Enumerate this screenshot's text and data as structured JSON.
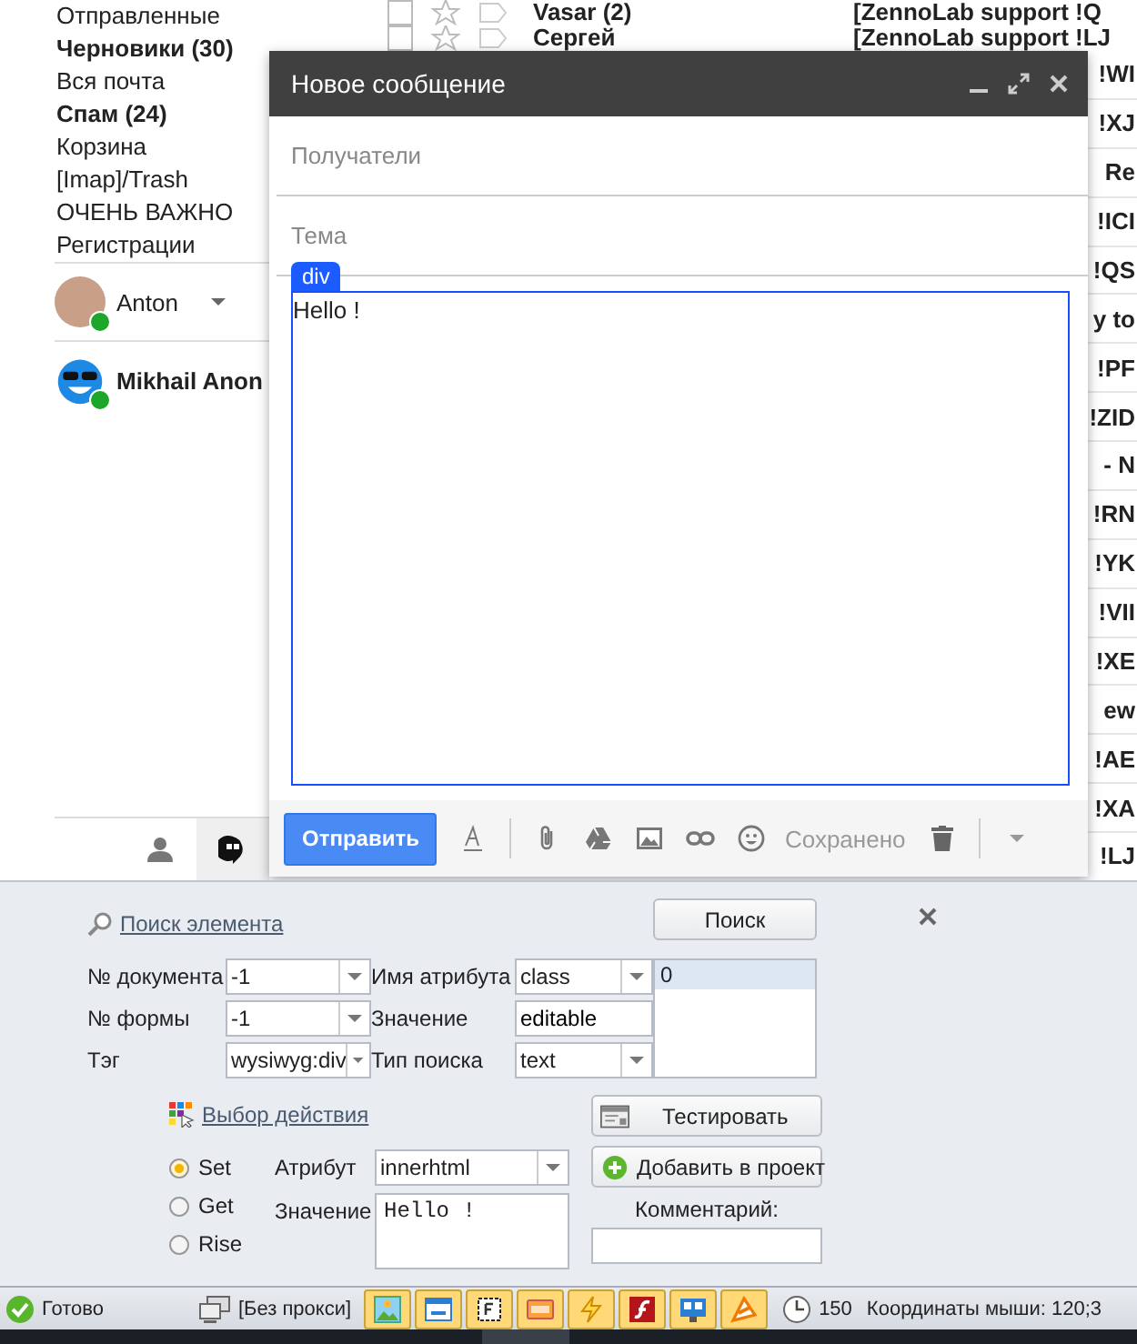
{
  "sidebar": {
    "folders": [
      {
        "label": "Отправленные",
        "bold": false
      },
      {
        "label": "Черновики (30)",
        "bold": true
      },
      {
        "label": "Вся почта",
        "bold": false
      },
      {
        "label": "Спам (24)",
        "bold": true
      },
      {
        "label": "Корзина",
        "bold": false
      },
      {
        "label": "[Imap]/Trash",
        "bold": false
      },
      {
        "label": "ОЧЕНЬ ВАЖНО",
        "bold": false
      },
      {
        "label": "Регистрации",
        "bold": false
      }
    ],
    "contacts": [
      {
        "name": "Anton",
        "kind": "photo",
        "online": true,
        "bold": false
      },
      {
        "name": "Mikhail Anon",
        "kind": "emoji",
        "online": true,
        "bold": true
      }
    ]
  },
  "mail_list": {
    "rows": [
      {
        "sender": "Vasar (2)",
        "subject": "[ZennoLab support !Q",
        "unread": true
      },
      {
        "sender": "Сергей",
        "subject": "[ZennoLab support !LJ",
        "unread": true
      },
      {
        "subject": "!WI",
        "unread": true
      },
      {
        "subject": "!XJ",
        "unread": true
      },
      {
        "subject": "Re",
        "unread": true
      },
      {
        "subject": "!ICI",
        "unread": true
      },
      {
        "subject": "!QS",
        "unread": true
      },
      {
        "subject": "y to",
        "unread": true
      },
      {
        "subject": "!PF",
        "unread": true
      },
      {
        "subject": "!ZID",
        "unread": true
      },
      {
        "subject": "- N",
        "unread": true
      },
      {
        "subject": "!RN",
        "unread": true
      },
      {
        "subject": "!YK",
        "unread": true
      },
      {
        "subject": "!VII",
        "unread": true
      },
      {
        "subject": "!XE",
        "unread": true
      },
      {
        "subject": "ew",
        "unread": true
      },
      {
        "subject": "!AE",
        "unread": true
      },
      {
        "subject": "!XA",
        "unread": true
      },
      {
        "subject": "!LJ",
        "unread": true
      }
    ]
  },
  "compose": {
    "title": "Новое сообщение",
    "recipients_placeholder": "Получатели",
    "subject_placeholder": "Тема",
    "highlight_tag": "div",
    "body": "Hello !",
    "send_label": "Отправить",
    "save_status": "Сохранено"
  },
  "element_search": {
    "title_link": "Поиск элемента",
    "search_button": "Поиск",
    "fields_left": [
      {
        "label": "№ документа",
        "value": "-1",
        "kind": "combo"
      },
      {
        "label": "№ формы",
        "value": "-1",
        "kind": "combo"
      },
      {
        "label": "Тэг",
        "value": "wysiwyg:div",
        "kind": "combo"
      }
    ],
    "fields_right": [
      {
        "label": "Имя атрибута",
        "value": "class",
        "kind": "combo"
      },
      {
        "label": "Значение",
        "value": "editable",
        "kind": "input"
      },
      {
        "label": "Тип поиска",
        "value": "text",
        "kind": "combo"
      }
    ],
    "results": [
      {
        "text": "0",
        "selected": true
      }
    ]
  },
  "action": {
    "title_link": "Выбор действия",
    "modes": [
      {
        "label": "Set",
        "selected": true
      },
      {
        "label": "Get",
        "selected": false
      },
      {
        "label": "Rise",
        "selected": false
      }
    ],
    "attribute_label": "Атрибут",
    "attribute_value": "innerhtml",
    "value_label": "Значение",
    "value_text": "Hello !",
    "test_button": "Тестировать",
    "add_button": "Добавить в проект",
    "comment_label": "Комментарий:"
  },
  "status_bar": {
    "status": "Готово",
    "proxy": "[Без прокси]",
    "tools": [
      {
        "kind": "image",
        "on": true
      },
      {
        "kind": "window",
        "on": true
      },
      {
        "kind": "frame",
        "on": true
      },
      {
        "kind": "css",
        "on": true
      },
      {
        "kind": "lightning",
        "on": true
      },
      {
        "kind": "flash",
        "on": true
      },
      {
        "kind": "monitor",
        "on": true
      },
      {
        "kind": "cone",
        "on": true
      }
    ],
    "threads": "150",
    "mouse": "Координаты мыши: 120;3"
  }
}
